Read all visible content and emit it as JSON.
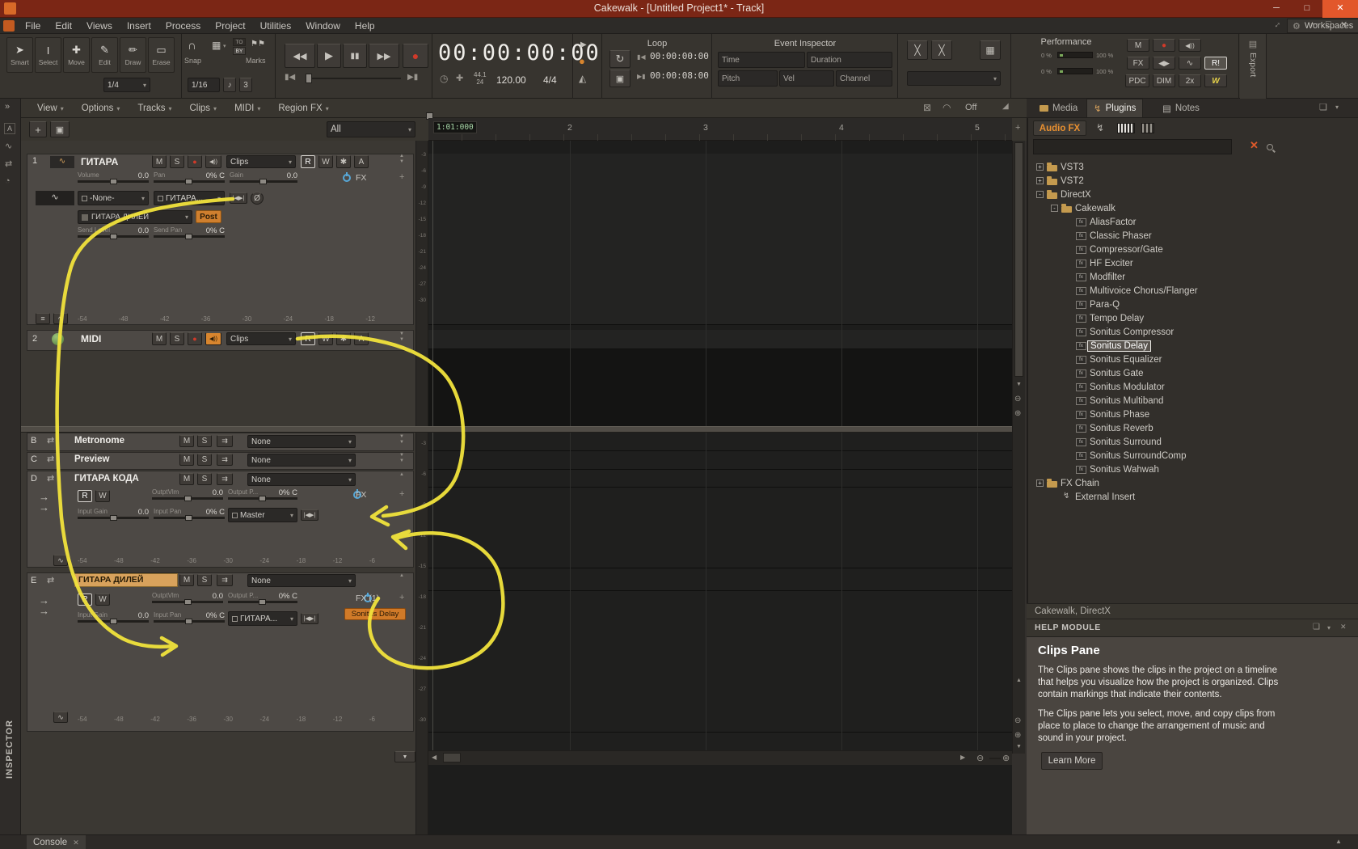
{
  "window": {
    "title": "Cakewalk - [Untitled Project1* - Track]"
  },
  "menubar": {
    "items": [
      "File",
      "Edit",
      "Views",
      "Insert",
      "Process",
      "Project",
      "Utilities",
      "Window",
      "Help"
    ],
    "workspaces_label": "Workspaces"
  },
  "toolbar": {
    "tools": [
      {
        "g": "➤",
        "label": "Smart"
      },
      {
        "g": "I",
        "label": "Select"
      },
      {
        "g": "✚",
        "label": "Move"
      },
      {
        "g": "✎",
        "label": "Edit"
      },
      {
        "g": "✏",
        "label": "Draw"
      },
      {
        "g": "▭",
        "label": "Erase"
      }
    ],
    "tool_option": "1/4",
    "snap": {
      "label": "Snap",
      "marks_label": "Marks",
      "to": "TO",
      "by": "BY",
      "value": "1/16",
      "note": "♪",
      "triplet": "3"
    },
    "time_display": "00:00:00:00",
    "sample_rate": "44.1",
    "bit_depth": "24",
    "tempo": "120.00",
    "meter": "4/4",
    "loop": {
      "title": "Loop",
      "start": "00:00:00:00",
      "end": "00:00:08:00"
    },
    "event_inspector": {
      "title": "Event Inspector",
      "time": "Time",
      "duration": "Duration",
      "pitch": "Pitch",
      "vel": "Vel",
      "channel": "Channel"
    },
    "performance": {
      "title": "Performance",
      "pct0": "0 %",
      "pct100": "100 %",
      "m": "M",
      "fx": "FX",
      "pdc": "PDC",
      "dim": "DIM",
      "x2": "2x",
      "r": "R!",
      "w": "W"
    },
    "export_label": "Export"
  },
  "trackview": {
    "menus": [
      {
        "label": "View"
      },
      {
        "label": "Options"
      },
      {
        "label": "Tracks"
      },
      {
        "label": "Clips"
      },
      {
        "label": "MIDI"
      },
      {
        "label": "Region FX"
      }
    ],
    "off_label": "Off",
    "filter_all": "All",
    "ruler_pos": "1:01:000",
    "measures": [
      "2",
      "3",
      "4",
      "5"
    ]
  },
  "track1": {
    "num": "1",
    "name": "ГИТАРА",
    "m": "M",
    "s": "S",
    "r": "R",
    "w": "W",
    "a": "A",
    "fz": "✱",
    "clips": "Clips",
    "volume_label": "Volume",
    "volume": "0.0",
    "pan_label": "Pan",
    "pan": "0% C",
    "gain_label": "Gain",
    "gain": "0.0",
    "fx": "FX",
    "input": "-None-",
    "output": "ГИТАРА...",
    "send_dest": "ГИТАРА ДИЛЕЙ",
    "send_mode": "Post",
    "send_level_label": "Send Level",
    "send_level": "0.0",
    "send_pan_label": "Send Pan",
    "send_pan": "0% C",
    "db_scale": [
      {
        "v": "-54"
      },
      {
        "v": "-48"
      },
      {
        "v": "-42"
      },
      {
        "v": "-36"
      },
      {
        "v": "-30"
      },
      {
        "v": "-24"
      },
      {
        "v": "-18"
      },
      {
        "v": "-12"
      }
    ]
  },
  "track2": {
    "num": "2",
    "name": "MIDI",
    "m": "M",
    "s": "S",
    "clips": "Clips",
    "r": "R",
    "w": "W",
    "a": "A",
    "fz": "✱"
  },
  "busB": {
    "id": "B",
    "name": "Metronome",
    "m": "M",
    "s": "S",
    "out": "None"
  },
  "busC": {
    "id": "C",
    "name": "Preview",
    "m": "M",
    "s": "S",
    "out": "None"
  },
  "busD": {
    "id": "D",
    "name": "ГИТАРА КОДА",
    "m": "M",
    "s": "S",
    "out": "None",
    "r": "R",
    "w": "W",
    "vol_label": "OutptVlm",
    "vol": "0.0",
    "opan_label": "Output P...",
    "opan": "0% C",
    "igain_label": "Input Gain",
    "igain": "0.0",
    "ipan_label": "Input Pan",
    "ipan": "0% C",
    "output": "Master",
    "fx": "FX",
    "db_scale": [
      {
        "v": "-54"
      },
      {
        "v": "-48"
      },
      {
        "v": "-42"
      },
      {
        "v": "-36"
      },
      {
        "v": "-30"
      },
      {
        "v": "-24"
      },
      {
        "v": "-18"
      },
      {
        "v": "-12"
      },
      {
        "v": "-6"
      }
    ]
  },
  "busE": {
    "id": "E",
    "name": "ГИТАРА ДИЛЕЙ",
    "m": "M",
    "s": "S",
    "out": "None",
    "r": "R",
    "w": "W",
    "vol_label": "OutptVlm",
    "vol": "0.0",
    "opan_label": "Output P...",
    "opan": "0% C",
    "igain_label": "Input Gain",
    "igain": "0.0",
    "ipan_label": "Input Pan",
    "ipan": "0% C",
    "output": "ГИТАРА...",
    "fx": "FX (1)",
    "fx_plugin": "Sonitus Delay",
    "db_scale": [
      {
        "v": "-54"
      },
      {
        "v": "-48"
      },
      {
        "v": "-42"
      },
      {
        "v": "-36"
      },
      {
        "v": "-30"
      },
      {
        "v": "-24"
      },
      {
        "v": "-18"
      },
      {
        "v": "-12"
      },
      {
        "v": "-6"
      }
    ]
  },
  "meter_scale": [
    {
      "v": "-3"
    },
    {
      "v": "-6"
    },
    {
      "v": "-9"
    },
    {
      "v": "-12"
    },
    {
      "v": "-15"
    },
    {
      "v": "-18"
    },
    {
      "v": "-21"
    },
    {
      "v": "-24"
    },
    {
      "v": "-27"
    },
    {
      "v": "-30"
    }
  ],
  "browser": {
    "tabs": [
      {
        "label": "Media",
        "cls": ""
      },
      {
        "label": "Plugins",
        "cls": "active"
      },
      {
        "label": "Notes",
        "cls": ""
      }
    ],
    "audio_fx": "Audio FX",
    "tree": [
      {
        "label": "VST3",
        "exp": "+",
        "cls": "lvl1 folder"
      },
      {
        "label": "VST2",
        "exp": "+",
        "cls": "lvl1 folder"
      },
      {
        "label": "DirectX",
        "exp": "-",
        "cls": "lvl1 folder"
      },
      {
        "label": "Cakewalk",
        "exp": "-",
        "cls": "lvl2 folder"
      },
      {
        "label": "AliasFactor",
        "exp": "",
        "cls": "lvl3 fx"
      },
      {
        "label": "Classic Phaser",
        "exp": "",
        "cls": "lvl3 fx"
      },
      {
        "label": "Compressor/Gate",
        "exp": "",
        "cls": "lvl3 fx"
      },
      {
        "label": "HF Exciter",
        "exp": "",
        "cls": "lvl3 fx"
      },
      {
        "label": "Modfilter",
        "exp": "",
        "cls": "lvl3 fx"
      },
      {
        "label": "Multivoice Chorus/Flanger",
        "exp": "",
        "cls": "lvl3 fx"
      },
      {
        "label": "Para-Q",
        "exp": "",
        "cls": "lvl3 fx"
      },
      {
        "label": "Tempo Delay",
        "exp": "",
        "cls": "lvl3 fx"
      },
      {
        "label": "Sonitus Compressor",
        "exp": "",
        "cls": "lvl3 fx"
      },
      {
        "label": "Sonitus Delay",
        "exp": "",
        "cls": "lvl3 fx sel"
      },
      {
        "label": "Sonitus Equalizer",
        "exp": "",
        "cls": "lvl3 fx"
      },
      {
        "label": "Sonitus Gate",
        "exp": "",
        "cls": "lvl3 fx"
      },
      {
        "label": "Sonitus Modulator",
        "exp": "",
        "cls": "lvl3 fx"
      },
      {
        "label": "Sonitus Multiband",
        "exp": "",
        "cls": "lvl3 fx"
      },
      {
        "label": "Sonitus Phase",
        "exp": "",
        "cls": "lvl3 fx"
      },
      {
        "label": "Sonitus Reverb",
        "exp": "",
        "cls": "lvl3 fx"
      },
      {
        "label": "Sonitus Surround",
        "exp": "",
        "cls": "lvl3 fx"
      },
      {
        "label": "Sonitus SurroundComp",
        "exp": "",
        "cls": "lvl3 fx"
      },
      {
        "label": "Sonitus Wahwah",
        "exp": "",
        "cls": "lvl3 fx"
      },
      {
        "label": "FX Chain",
        "exp": "+",
        "cls": "lvl1 folder"
      },
      {
        "label": "External Insert",
        "exp": "",
        "cls": "lvl2 plug"
      }
    ],
    "status": "Cakewalk, DirectX"
  },
  "help": {
    "module_title": "HELP MODULE",
    "heading": "Clips Pane",
    "p1": "The Clips pane shows the clips in the project on a timeline that helps you visualize how the project is organized. Clips contain markings that indicate their contents.",
    "p2": "The Clips pane lets you select, move, and copy clips from place to place to change the arrangement of music and sound in your project.",
    "learn_more": "Learn More"
  },
  "statusbar": {
    "console": "Console"
  },
  "inspector_label": "INSPECTOR",
  "colors": {
    "accent_orange": "#e08a2e",
    "selection_tan": "#d8a25c",
    "annotation_yellow": "#f1e33c",
    "record_red": "#c93a2a",
    "titlebar_red": "#7b2615"
  }
}
